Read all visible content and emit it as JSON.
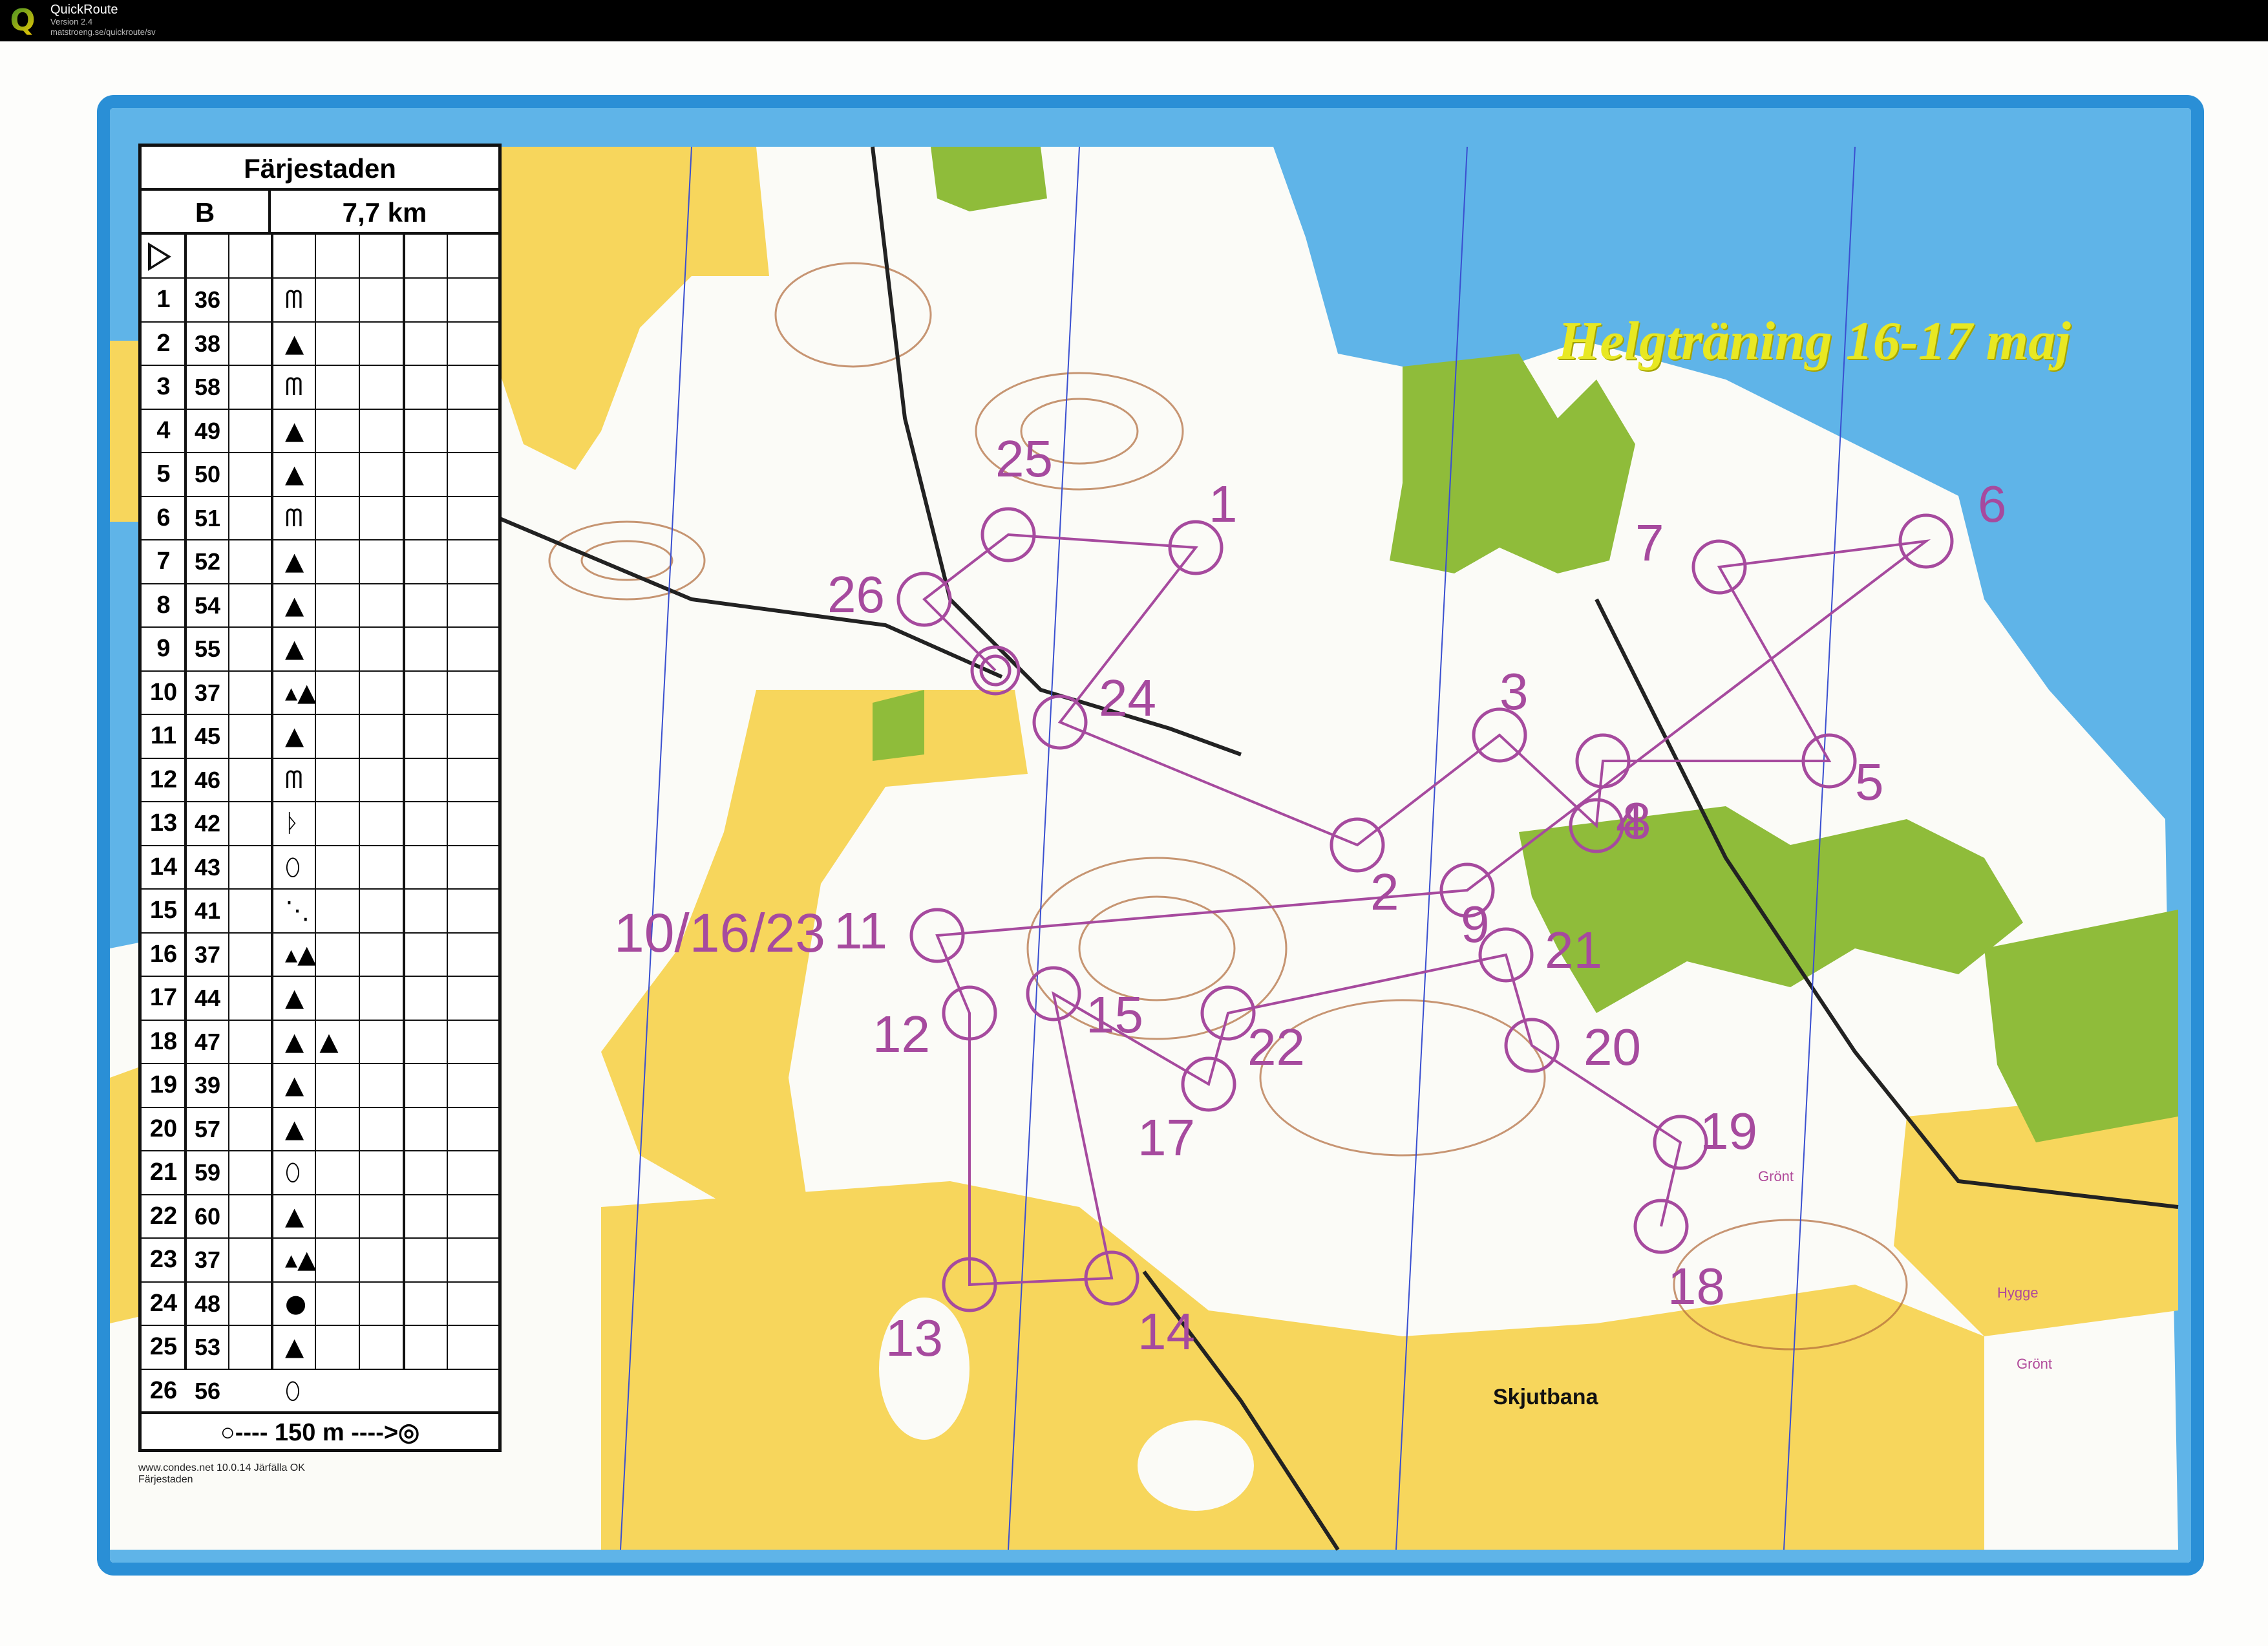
{
  "app": {
    "title": "QuickRoute",
    "version": "Version 2.4",
    "url": "matstroeng.se/quickroute/sv",
    "icon": "quickroute-q-icon"
  },
  "control_table": {
    "title": "Färjestaden",
    "course": "B",
    "length": "7,7 km",
    "start_symbol": "start-triangle-icon",
    "controls": [
      {
        "num": "1",
        "code": "36",
        "symbol": "ᗰ"
      },
      {
        "num": "2",
        "code": "38",
        "symbol": "▲"
      },
      {
        "num": "3",
        "code": "58",
        "symbol": "ᗰ"
      },
      {
        "num": "4",
        "code": "49",
        "symbol": "▲"
      },
      {
        "num": "5",
        "code": "50",
        "symbol": "▲"
      },
      {
        "num": "6",
        "code": "51",
        "symbol": "ᗰ"
      },
      {
        "num": "7",
        "code": "52",
        "symbol": "▲"
      },
      {
        "num": "8",
        "code": "54",
        "symbol": "▲"
      },
      {
        "num": "9",
        "code": "55",
        "symbol": "▲"
      },
      {
        "num": "10",
        "code": "37",
        "symbol": "▴▲"
      },
      {
        "num": "11",
        "code": "45",
        "symbol": "▲"
      },
      {
        "num": "12",
        "code": "46",
        "symbol": "ᗰ"
      },
      {
        "num": "13",
        "code": "42",
        "symbol": "ᚦ"
      },
      {
        "num": "14",
        "code": "43",
        "symbol": "⬯"
      },
      {
        "num": "15",
        "code": "41",
        "symbol": "⋱"
      },
      {
        "num": "16",
        "code": "37",
        "symbol": "▴▲"
      },
      {
        "num": "17",
        "code": "44",
        "symbol": "▲"
      },
      {
        "num": "18",
        "code": "47",
        "symbol": "▲  ▲"
      },
      {
        "num": "19",
        "code": "39",
        "symbol": "▲"
      },
      {
        "num": "20",
        "code": "57",
        "symbol": "▲"
      },
      {
        "num": "21",
        "code": "59",
        "symbol": "⬯"
      },
      {
        "num": "22",
        "code": "60",
        "symbol": "▲"
      },
      {
        "num": "23",
        "code": "37",
        "symbol": "▴▲"
      },
      {
        "num": "24",
        "code": "48",
        "symbol": "●"
      },
      {
        "num": "25",
        "code": "53",
        "symbol": "▲"
      },
      {
        "num": "26",
        "code": "56",
        "symbol": "⬯"
      }
    ],
    "finish": "○---- 150 m ---->◎",
    "credit_line1": "www.condes.net 10.0.14 Järfälla OK",
    "credit_line2": "Färjestaden"
  },
  "map": {
    "title": "Helgträning 16-17 maj",
    "multi_control_label": "10/16/23",
    "skjutbana": "Skjutbana",
    "small_labels": [
      "Grönt",
      "Hygge",
      "Grönt"
    ],
    "colors": {
      "water": "#5fb4e8",
      "open_land": "#f7d65c",
      "forest": "#fbfbf7",
      "settlement": "#8fbc3a",
      "course": "#a64a9e",
      "contour": "#b06a3a",
      "frame": "#2a8fd6"
    },
    "controls": [
      {
        "label": "1"
      },
      {
        "label": "2"
      },
      {
        "label": "3"
      },
      {
        "label": "4"
      },
      {
        "label": "5"
      },
      {
        "label": "6"
      },
      {
        "label": "7"
      },
      {
        "label": "8"
      },
      {
        "label": "9"
      },
      {
        "label": "11"
      },
      {
        "label": "12"
      },
      {
        "label": "13"
      },
      {
        "label": "14"
      },
      {
        "label": "15"
      },
      {
        "label": "17"
      },
      {
        "label": "18"
      },
      {
        "label": "19"
      },
      {
        "label": "20"
      },
      {
        "label": "21"
      },
      {
        "label": "22"
      },
      {
        "label": "24"
      },
      {
        "label": "25"
      },
      {
        "label": "26"
      }
    ]
  }
}
